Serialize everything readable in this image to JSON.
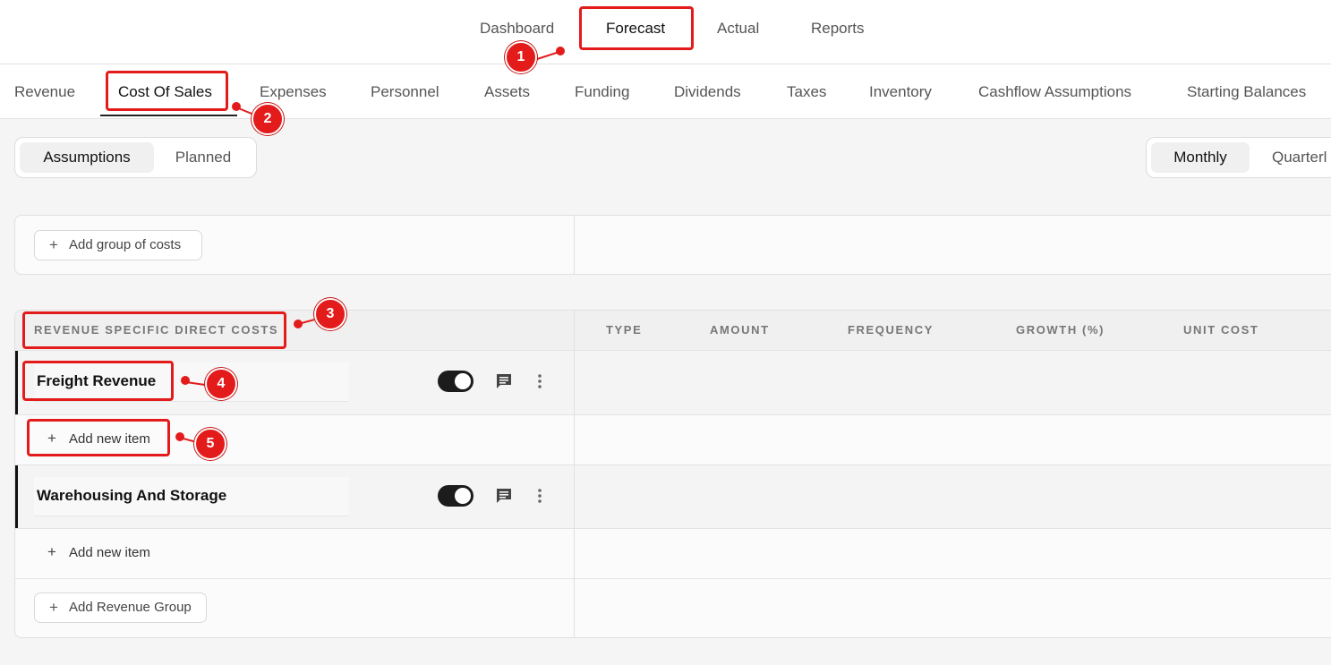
{
  "top_nav": {
    "tabs": [
      {
        "label": "Dashboard"
      },
      {
        "label": "Forecast"
      },
      {
        "label": "Actual"
      },
      {
        "label": "Reports"
      }
    ]
  },
  "sub_nav": {
    "tabs": [
      {
        "label": "Revenue"
      },
      {
        "label": "Cost Of Sales"
      },
      {
        "label": "Expenses"
      },
      {
        "label": "Personnel"
      },
      {
        "label": "Assets"
      },
      {
        "label": "Funding"
      },
      {
        "label": "Dividends"
      },
      {
        "label": "Taxes"
      },
      {
        "label": "Inventory"
      },
      {
        "label": "Cashflow Assumptions"
      },
      {
        "label": "Starting Balances"
      }
    ],
    "active": "Cost Of Sales"
  },
  "view_toggle": {
    "options": [
      {
        "label": "Assumptions"
      },
      {
        "label": "Planned"
      }
    ],
    "selected": "Assumptions"
  },
  "period_toggle": {
    "options": [
      {
        "label": "Monthly"
      },
      {
        "label": "Quarterl"
      }
    ],
    "selected": "Monthly"
  },
  "add_group_costs_label": "Add group of costs",
  "table": {
    "section_title": "REVENUE SPECIFIC DIRECT COSTS",
    "columns": [
      "TYPE",
      "AMOUNT",
      "FREQUENCY",
      "GROWTH (%)",
      "UNIT COST"
    ],
    "groups": [
      {
        "name": "Freight Revenue",
        "add_item_label": "Add new item",
        "enabled": true
      },
      {
        "name": "Warehousing And Storage",
        "add_item_label": "Add new item",
        "enabled": true
      }
    ],
    "add_group_label": "Add Revenue Group"
  },
  "annotations": [
    "1",
    "2",
    "3",
    "4",
    "5"
  ],
  "colors": {
    "annotation": "#e31b1b",
    "toggle_on": "#1c1c1c"
  }
}
